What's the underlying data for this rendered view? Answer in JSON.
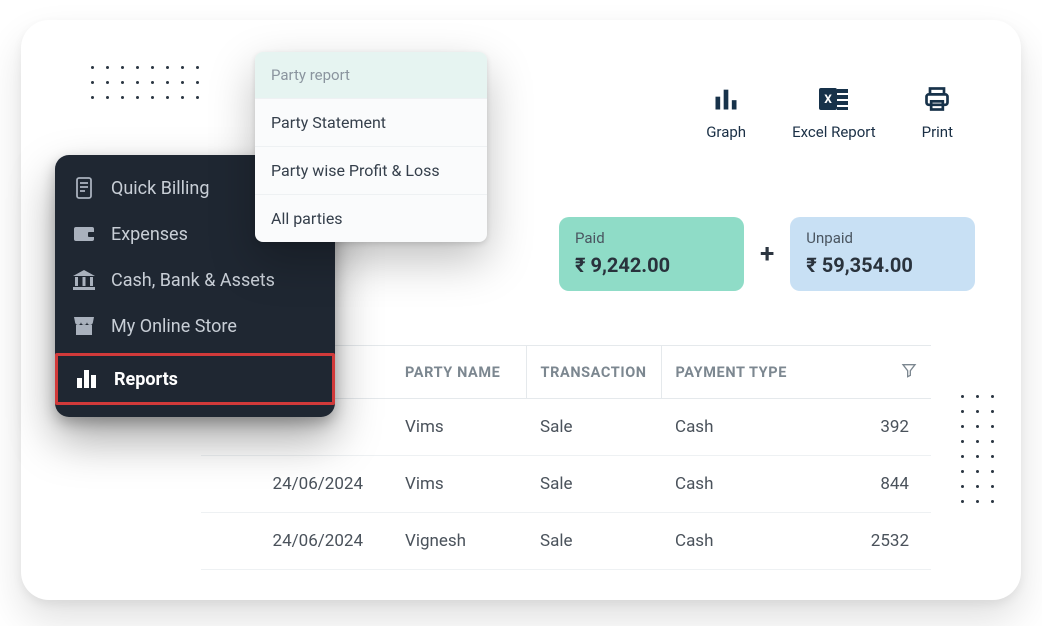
{
  "sidebar": {
    "items": [
      {
        "label": "Quick Billing"
      },
      {
        "label": "Expenses"
      },
      {
        "label": "Cash, Bank & Assets"
      },
      {
        "label": "My Online Store"
      },
      {
        "label": "Reports",
        "active": true
      }
    ]
  },
  "popover": {
    "header": "Party report",
    "items": [
      "Party Statement",
      "Party wise Profit & Loss",
      "All parties"
    ]
  },
  "actions": {
    "graph": "Graph",
    "excel": "Excel Report",
    "print": "Print"
  },
  "summary": {
    "paid": {
      "label": "Paid",
      "value": "₹ 9,242.00"
    },
    "unpaid": {
      "label": "Unpaid",
      "value": "₹ 59,354.00"
    }
  },
  "table": {
    "headers": {
      "party": "PARTY NAME",
      "transaction": "TRANSACTION",
      "payment_type": "PAYMENT TYPE"
    },
    "rows": [
      {
        "date": "",
        "party": "Vims",
        "txn": "Sale",
        "pay": "Cash",
        "amount": "392"
      },
      {
        "date": "24/06/2024",
        "party": "Vims",
        "txn": "Sale",
        "pay": "Cash",
        "amount": "844"
      },
      {
        "date": "24/06/2024",
        "party": "Vignesh",
        "txn": "Sale",
        "pay": "Cash",
        "amount": "2532"
      }
    ]
  }
}
